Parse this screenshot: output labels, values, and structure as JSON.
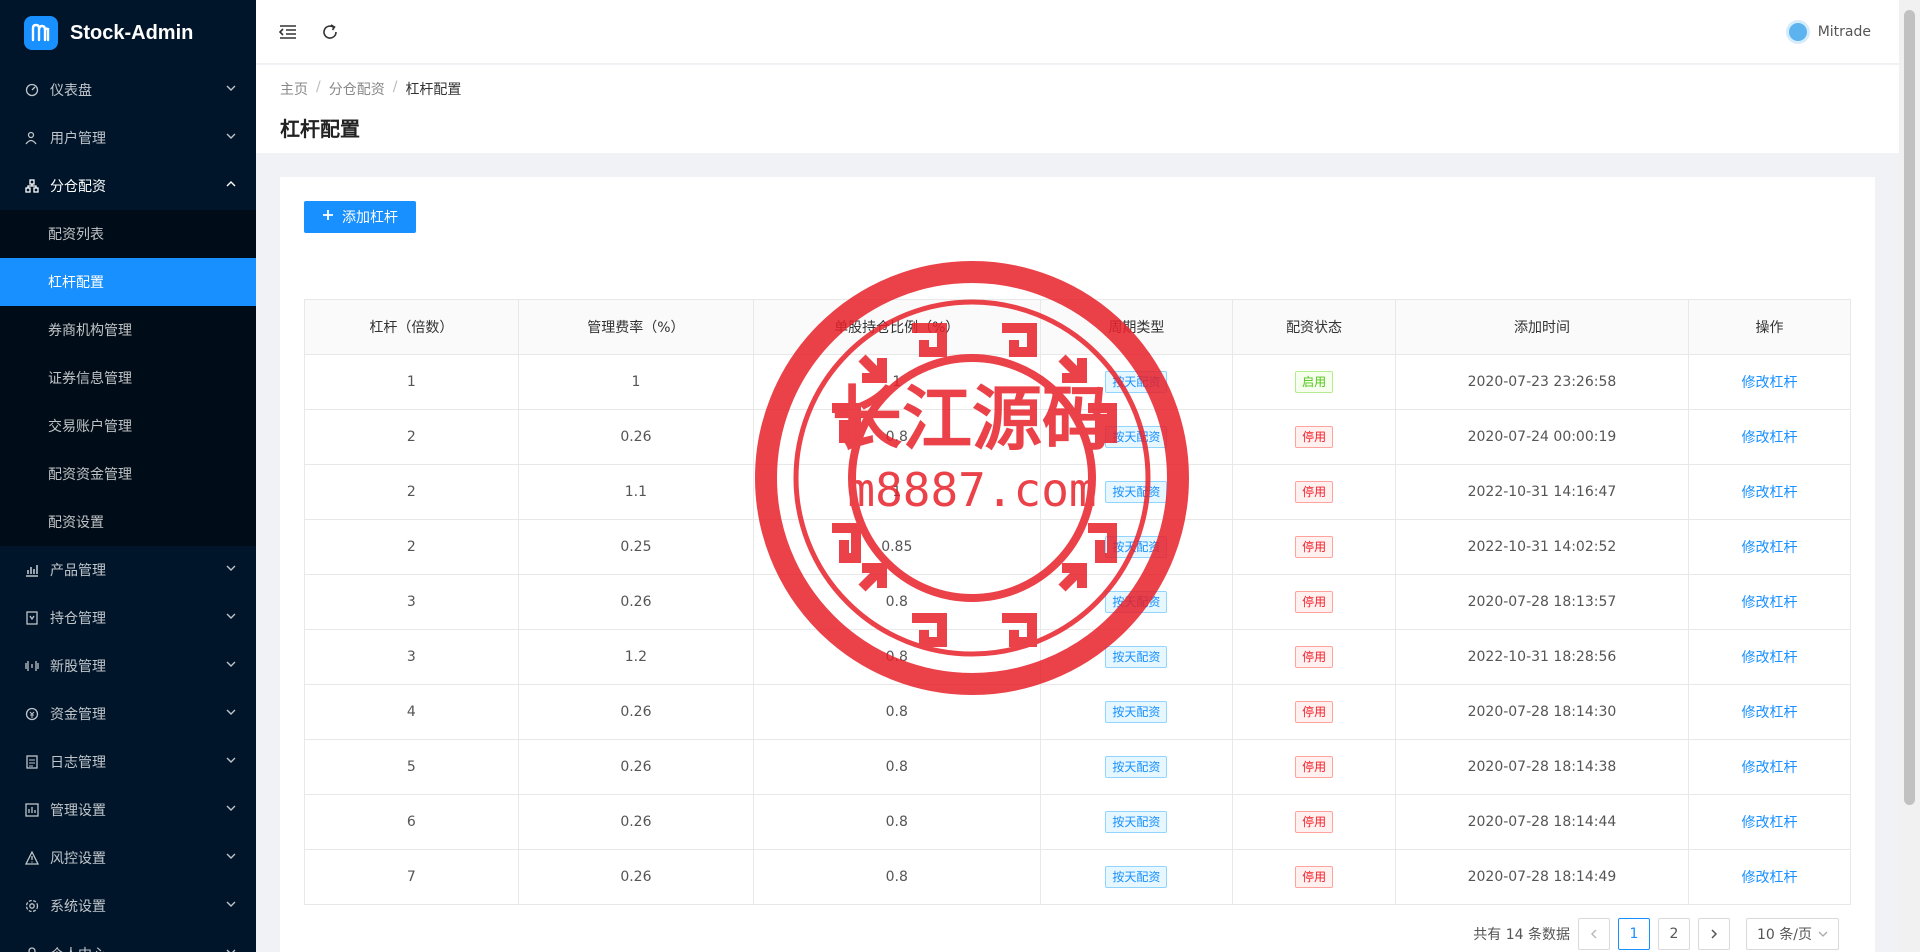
{
  "app": {
    "title": "Stock-Admin"
  },
  "sidebar": {
    "menus": [
      {
        "label": "仪表盘",
        "icon": "dashboard-icon"
      },
      {
        "label": "用户管理",
        "icon": "user-icon"
      },
      {
        "label": "分仓配资",
        "icon": "cluster-icon",
        "open": true
      }
    ],
    "submenu": [
      {
        "label": "配资列表"
      },
      {
        "label": "杠杆配置",
        "active": true
      },
      {
        "label": "券商机构管理"
      },
      {
        "label": "证券信息管理"
      },
      {
        "label": "交易账户管理"
      },
      {
        "label": "配资资金管理"
      },
      {
        "label": "配资设置"
      }
    ],
    "menus_after": [
      {
        "label": "产品管理",
        "icon": "chart-icon"
      },
      {
        "label": "持仓管理",
        "icon": "position-icon"
      },
      {
        "label": "新股管理",
        "icon": "signal-icon"
      },
      {
        "label": "资金管理",
        "icon": "money-icon"
      },
      {
        "label": "日志管理",
        "icon": "log-icon"
      },
      {
        "label": "管理设置",
        "icon": "setting-box-icon"
      },
      {
        "label": "风控设置",
        "icon": "warning-icon"
      },
      {
        "label": "系统设置",
        "icon": "gear-icon"
      },
      {
        "label": "个人中心",
        "icon": "person-icon"
      }
    ]
  },
  "header": {
    "username": "Mitrade"
  },
  "breadcrumb": {
    "items": [
      "主页",
      "分仓配资",
      "杠杆配置"
    ]
  },
  "page": {
    "title": "杠杆配置"
  },
  "toolbar": {
    "add_label": "添加杠杆"
  },
  "table": {
    "columns": [
      "杠杆（倍数）",
      "管理费率（%）",
      "单股持仓比例（%）",
      "周期类型",
      "配资状态",
      "添加时间",
      "操作"
    ],
    "rows": [
      {
        "lever": "1",
        "fee": "1",
        "ratio": "1",
        "cycle": "按天配资",
        "status": "启用",
        "status_type": "green",
        "time": "2020-07-23 23:26:58",
        "action": "修改杠杆"
      },
      {
        "lever": "2",
        "fee": "0.26",
        "ratio": "0.8",
        "cycle": "按天配资",
        "status": "停用",
        "status_type": "red",
        "time": "2020-07-24 00:00:19",
        "action": "修改杠杆"
      },
      {
        "lever": "2",
        "fee": "1.1",
        "ratio": "1",
        "cycle": "按天配资",
        "status": "停用",
        "status_type": "red",
        "time": "2022-10-31 14:16:47",
        "action": "修改杠杆"
      },
      {
        "lever": "2",
        "fee": "0.25",
        "ratio": "0.85",
        "cycle": "按天配资",
        "status": "停用",
        "status_type": "red",
        "time": "2022-10-31 14:02:52",
        "action": "修改杠杆"
      },
      {
        "lever": "3",
        "fee": "0.26",
        "ratio": "0.8",
        "cycle": "按天配资",
        "status": "停用",
        "status_type": "red",
        "time": "2020-07-28 18:13:57",
        "action": "修改杠杆"
      },
      {
        "lever": "3",
        "fee": "1.2",
        "ratio": "0.8",
        "cycle": "按天配资",
        "status": "停用",
        "status_type": "red",
        "time": "2022-10-31 18:28:56",
        "action": "修改杠杆"
      },
      {
        "lever": "4",
        "fee": "0.26",
        "ratio": "0.8",
        "cycle": "按天配资",
        "status": "停用",
        "status_type": "red",
        "time": "2020-07-28 18:14:30",
        "action": "修改杠杆"
      },
      {
        "lever": "5",
        "fee": "0.26",
        "ratio": "0.8",
        "cycle": "按天配资",
        "status": "停用",
        "status_type": "red",
        "time": "2020-07-28 18:14:38",
        "action": "修改杠杆"
      },
      {
        "lever": "6",
        "fee": "0.26",
        "ratio": "0.8",
        "cycle": "按天配资",
        "status": "停用",
        "status_type": "red",
        "time": "2020-07-28 18:14:44",
        "action": "修改杠杆"
      },
      {
        "lever": "7",
        "fee": "0.26",
        "ratio": "0.8",
        "cycle": "按天配资",
        "status": "停用",
        "status_type": "red",
        "time": "2020-07-28 18:14:49",
        "action": "修改杠杆"
      }
    ]
  },
  "pagination": {
    "total_text": "共有 14 条数据",
    "pages": [
      "1",
      "2"
    ],
    "current": "1",
    "page_size": "10 条/页"
  },
  "watermark": {
    "line1": "长江源码",
    "line2": "m8887.com"
  },
  "colors": {
    "primary": "#1890ff",
    "sidebar": "#001529",
    "watermark": "#e8202a"
  }
}
